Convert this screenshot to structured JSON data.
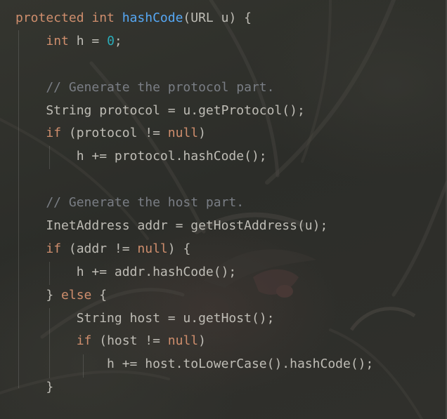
{
  "code_lines": [
    [
      {
        "t": "protected int ",
        "c": "kw"
      },
      {
        "t": "hashCode",
        "c": "fn"
      },
      {
        "t": "(URL u) {",
        "c": "tx"
      }
    ],
    [
      {
        "t": "    ",
        "c": "tx"
      },
      {
        "t": "int",
        "c": "kw"
      },
      {
        "t": " h = ",
        "c": "tx"
      },
      {
        "t": "0",
        "c": "num"
      },
      {
        "t": ";",
        "c": "tx"
      }
    ],
    [],
    [
      {
        "t": "    // Generate the protocol part.",
        "c": "cm"
      }
    ],
    [
      {
        "t": "    String protocol = u.getProtocol();",
        "c": "tx"
      }
    ],
    [
      {
        "t": "    ",
        "c": "tx"
      },
      {
        "t": "if",
        "c": "kw"
      },
      {
        "t": " (protocol != ",
        "c": "tx"
      },
      {
        "t": "null",
        "c": "kw"
      },
      {
        "t": ")",
        "c": "tx"
      }
    ],
    [
      {
        "t": "        h += protocol.hashCode();",
        "c": "tx"
      }
    ],
    [],
    [
      {
        "t": "    // Generate the host part.",
        "c": "cm"
      }
    ],
    [
      {
        "t": "    InetAddress addr = getHostAddress(u);",
        "c": "tx"
      }
    ],
    [
      {
        "t": "    ",
        "c": "tx"
      },
      {
        "t": "if",
        "c": "kw"
      },
      {
        "t": " (addr != ",
        "c": "tx"
      },
      {
        "t": "null",
        "c": "kw"
      },
      {
        "t": ") {",
        "c": "tx"
      }
    ],
    [
      {
        "t": "        h += addr.hashCode();",
        "c": "tx"
      }
    ],
    [
      {
        "t": "    } ",
        "c": "tx"
      },
      {
        "t": "else",
        "c": "kw"
      },
      {
        "t": " {",
        "c": "tx"
      }
    ],
    [
      {
        "t": "        String host = u.getHost();",
        "c": "tx"
      }
    ],
    [
      {
        "t": "        ",
        "c": "tx"
      },
      {
        "t": "if",
        "c": "kw"
      },
      {
        "t": " (host != ",
        "c": "tx"
      },
      {
        "t": "null",
        "c": "kw"
      },
      {
        "t": ")",
        "c": "tx"
      }
    ],
    [
      {
        "t": "            h += host.toLowerCase().hashCode();",
        "c": "tx"
      }
    ],
    [
      {
        "t": "    }",
        "c": "tx"
      }
    ]
  ],
  "colors": {
    "keyword": "#cf8e6d",
    "function": "#56a8f5",
    "number": "#2aacb8",
    "comment": "#7a7e85",
    "text": "#bfbdb6"
  }
}
